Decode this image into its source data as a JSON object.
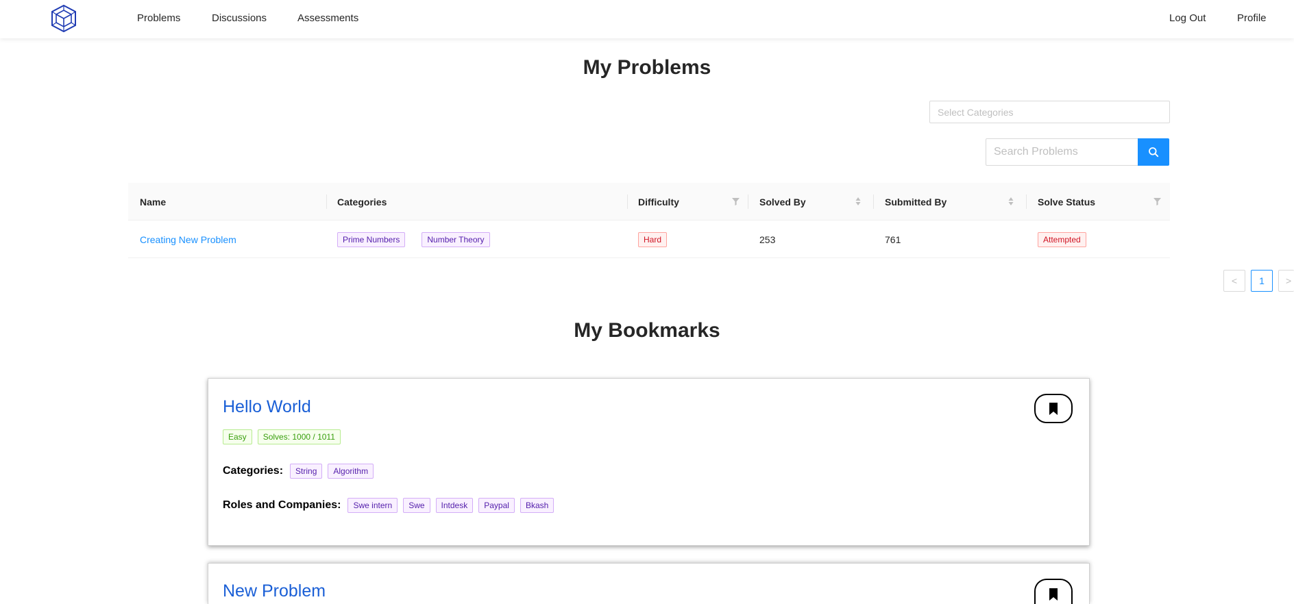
{
  "nav": {
    "links": [
      "Problems",
      "Discussions",
      "Assessments"
    ],
    "right_links": [
      "Log Out",
      "Profile"
    ],
    "logo_icon": "cube-logo-icon",
    "logo_color": "#1f3bb3"
  },
  "my_problems": {
    "title": "My Problems",
    "category_select_placeholder": "Select Categories",
    "search_placeholder": "Search Problems",
    "search_icon": "search-icon",
    "accent": "#1890ff",
    "columns": [
      "Name",
      "Categories",
      "Difficulty",
      "Solved By",
      "Submitted By",
      "Solve Status"
    ],
    "rows": [
      {
        "name": "Creating New Problem",
        "categories": [
          "Prime Numbers",
          "Number Theory"
        ],
        "difficulty": "Hard",
        "solved_by": "253",
        "submitted_by": "761",
        "solve_status": "Attempted"
      }
    ],
    "pagination": {
      "prev": "<",
      "current": "1",
      "next": ">"
    }
  },
  "my_bookmarks": {
    "title": "My Bookmarks",
    "categories_label": "Categories:",
    "roles_label": "Roles and Companies:",
    "bookmark_icon": "bookmark-icon",
    "cards": [
      {
        "title": "Hello World",
        "difficulty": "Easy",
        "solves": "Solves: 1000 / 1011",
        "categories": [
          "String",
          "Algorithm"
        ],
        "roles": [
          "Swe intern",
          "Swe",
          "Intdesk",
          "Paypal",
          "Bkash"
        ]
      },
      {
        "title": "New Problem"
      }
    ]
  }
}
